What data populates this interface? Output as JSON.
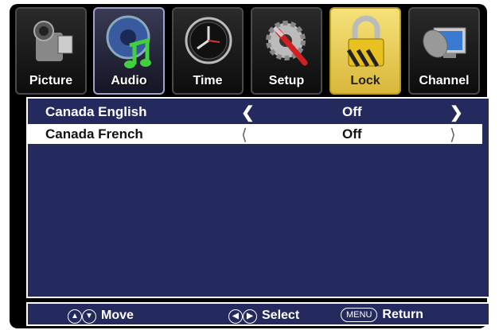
{
  "tabs": [
    {
      "label": "Picture",
      "icon": "camcorder-icon"
    },
    {
      "label": "Audio",
      "icon": "music-note-icon"
    },
    {
      "label": "Time",
      "icon": "clock-icon"
    },
    {
      "label": "Setup",
      "icon": "gear-wrench-icon"
    },
    {
      "label": "Lock",
      "icon": "padlock-icon"
    },
    {
      "label": "Channel",
      "icon": "satellite-dish-icon"
    }
  ],
  "rows": [
    {
      "name": "Canada English",
      "value": "Off"
    },
    {
      "name": "Canada French",
      "value": "Off"
    }
  ],
  "footer": {
    "move": "Move",
    "select": "Select",
    "menu_key": "MENU",
    "return": "Return"
  },
  "colors": {
    "panel_bg": "#252a5e",
    "lock_tab": "#f0d25a"
  }
}
